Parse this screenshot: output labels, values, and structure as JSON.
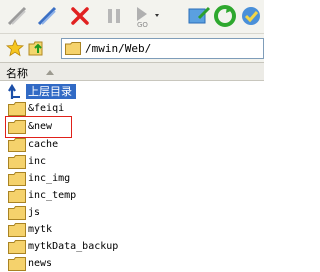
{
  "toolbar": {
    "buttons": [
      {
        "name": "connect-icon",
        "label": ""
      },
      {
        "name": "disconnect-icon",
        "label": ""
      },
      {
        "name": "stop-icon",
        "label": ""
      },
      {
        "name": "pause-icon",
        "label": ""
      },
      {
        "name": "go-icon",
        "label": "GO"
      },
      {
        "name": "queue-icon",
        "label": ""
      },
      {
        "name": "refresh-icon",
        "label": ""
      },
      {
        "name": "clean-icon",
        "label": ""
      }
    ]
  },
  "address": {
    "path": "/mwin/Web/"
  },
  "header": {
    "name_column": "名称"
  },
  "list": {
    "parent_label": "上层目录",
    "items": [
      "&feiqi",
      "&new",
      "cache",
      "inc",
      "inc_img",
      "inc_temp",
      "js",
      "mytk",
      "mytkData_backup",
      "news"
    ]
  },
  "colors": {
    "selection": "#316ac5",
    "highlight_box": "#e0211a",
    "folder": "#f5d26c"
  }
}
